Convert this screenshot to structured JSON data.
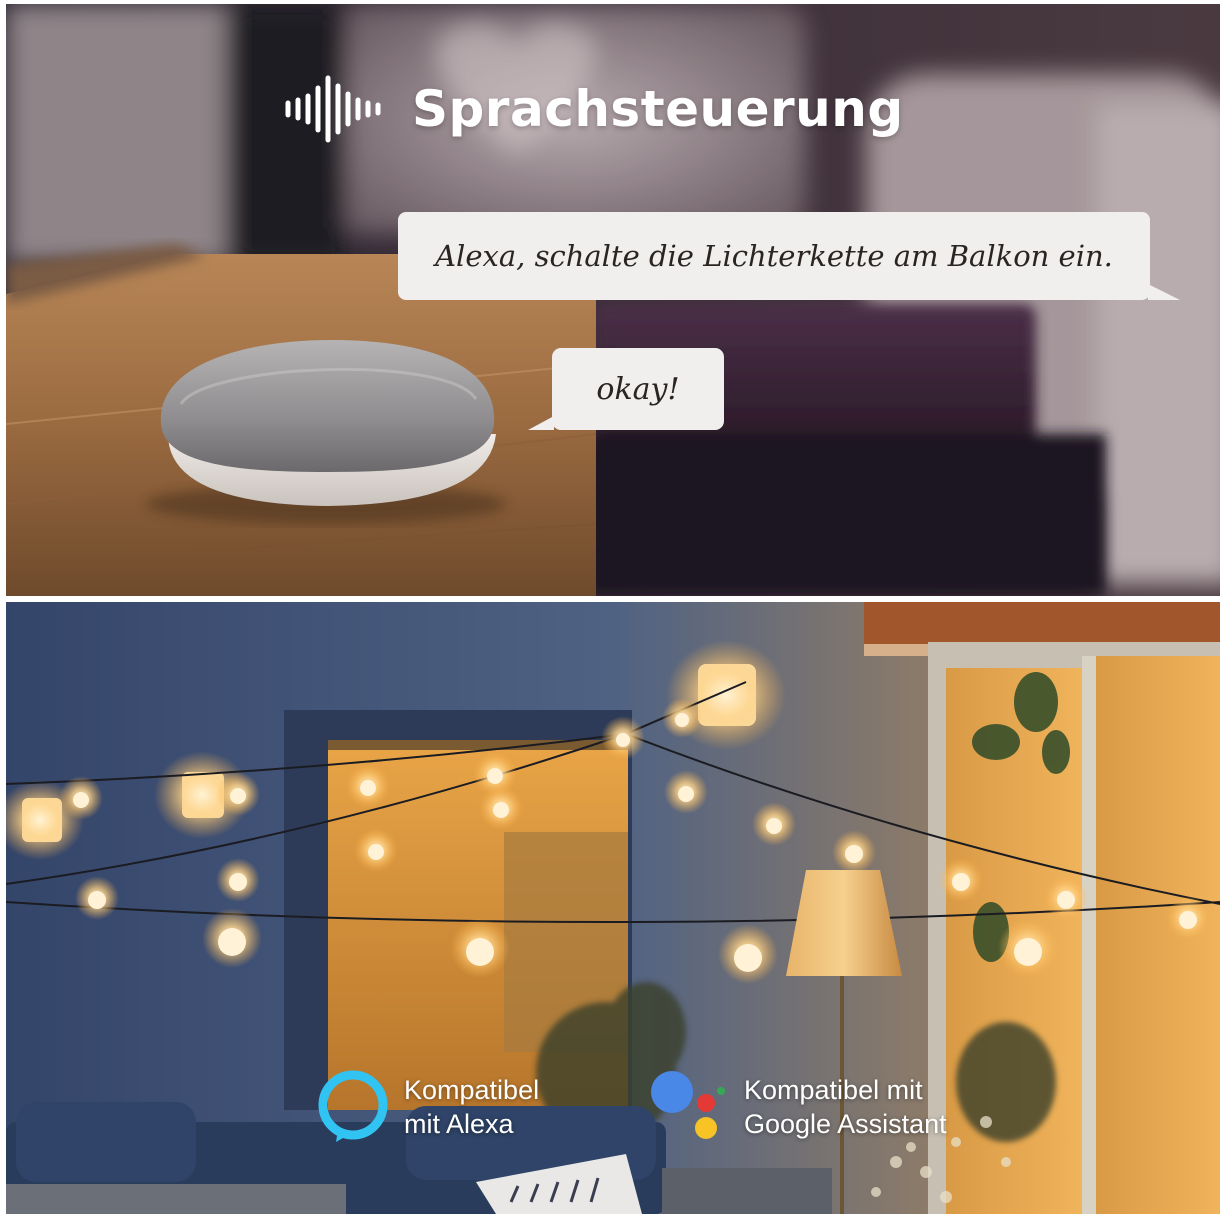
{
  "heading": {
    "icon": "sound-wave-icon",
    "title": "Sprachsteuerung"
  },
  "speech": {
    "command": "Alexa, schalte die Lichterkette am Balkon ein.",
    "reply": "okay!"
  },
  "badges": {
    "alexa": {
      "icon": "alexa-logo-icon",
      "line1": "Kompatibel",
      "line2": "mit Alexa"
    },
    "google": {
      "icon": "google-assistant-logo-icon",
      "line1": "Kompatibel mit",
      "line2": "Google Assistant"
    }
  },
  "colors": {
    "alexa": "#31c4f3",
    "google_blue": "#4a88e8",
    "google_red": "#e53935",
    "google_yellow": "#f7c325",
    "google_green": "#34a853",
    "bubble": "#f1efee",
    "bulb_glow": "#ffd58a"
  }
}
